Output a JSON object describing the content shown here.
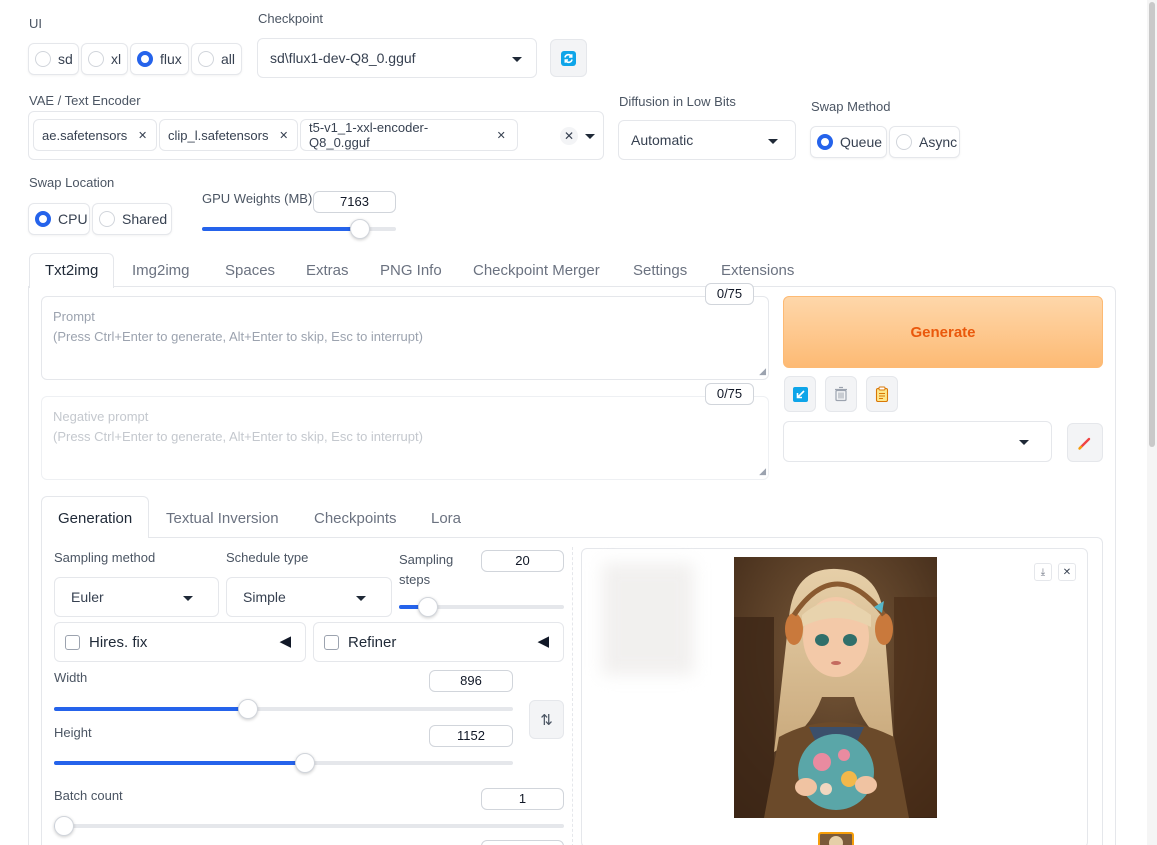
{
  "ui": {
    "label": "UI",
    "options": [
      "sd",
      "xl",
      "flux",
      "all"
    ],
    "selected": "flux"
  },
  "checkpoint": {
    "label": "Checkpoint",
    "value": "sd\\flux1-dev-Q8_0.gguf",
    "refresh_icon": "refresh-icon"
  },
  "vae": {
    "label": "VAE / Text Encoder",
    "tokens": [
      "ae.safetensors",
      "clip_l.safetensors",
      "t5-v1_1-xxl-encoder-Q8_0.gguf"
    ]
  },
  "diffusion_low_bits": {
    "label": "Diffusion in Low Bits",
    "value": "Automatic"
  },
  "swap_method": {
    "label": "Swap Method",
    "options": [
      "Queue",
      "Async"
    ],
    "selected": "Queue"
  },
  "swap_location": {
    "label": "Swap Location",
    "options": [
      "CPU",
      "Shared"
    ],
    "selected": "CPU"
  },
  "gpu_weights": {
    "label": "GPU Weights (MB)",
    "value": "7163",
    "level": 0.85
  },
  "main_tabs": [
    "Txt2img",
    "Img2img",
    "Spaces",
    "Extras",
    "PNG Info",
    "Checkpoint Merger",
    "Settings",
    "Extensions"
  ],
  "prompt": {
    "label": "Prompt",
    "placeholder": "(Press Ctrl+Enter to generate, Alt+Enter to skip, Esc to interrupt)",
    "counter": "0/75"
  },
  "negative_prompt": {
    "label": "Negative prompt",
    "placeholder": "(Press Ctrl+Enter to generate, Alt+Enter to skip, Esc to interrupt)",
    "counter": "0/75"
  },
  "generate_label": "Generate",
  "tool_icons": [
    "arrow-diagonal-icon",
    "trash-icon",
    "clipboard-icon",
    "pencil-icon"
  ],
  "sub_tabs": [
    "Generation",
    "Textual Inversion",
    "Checkpoints",
    "Lora"
  ],
  "sampling": {
    "method_label": "Sampling method",
    "method": "Euler",
    "schedule_label": "Schedule type",
    "schedule": "Simple",
    "steps_label": "Sampling steps",
    "steps": "20",
    "steps_level": 0.13
  },
  "hires_label": "Hires. fix",
  "refiner_label": "Refiner",
  "width": {
    "label": "Width",
    "value": "896",
    "level": 0.42
  },
  "height": {
    "label": "Height",
    "value": "1152",
    "level": 0.55
  },
  "batch_count": {
    "label": "Batch count",
    "value": "1",
    "level": 0.0
  },
  "gallery": {
    "download_icon": "download-icon",
    "close_icon": "close-icon"
  },
  "colors": {
    "accent": "#2563eb",
    "generate_text": "#ea580c",
    "generate_bg": "#fdba74"
  }
}
